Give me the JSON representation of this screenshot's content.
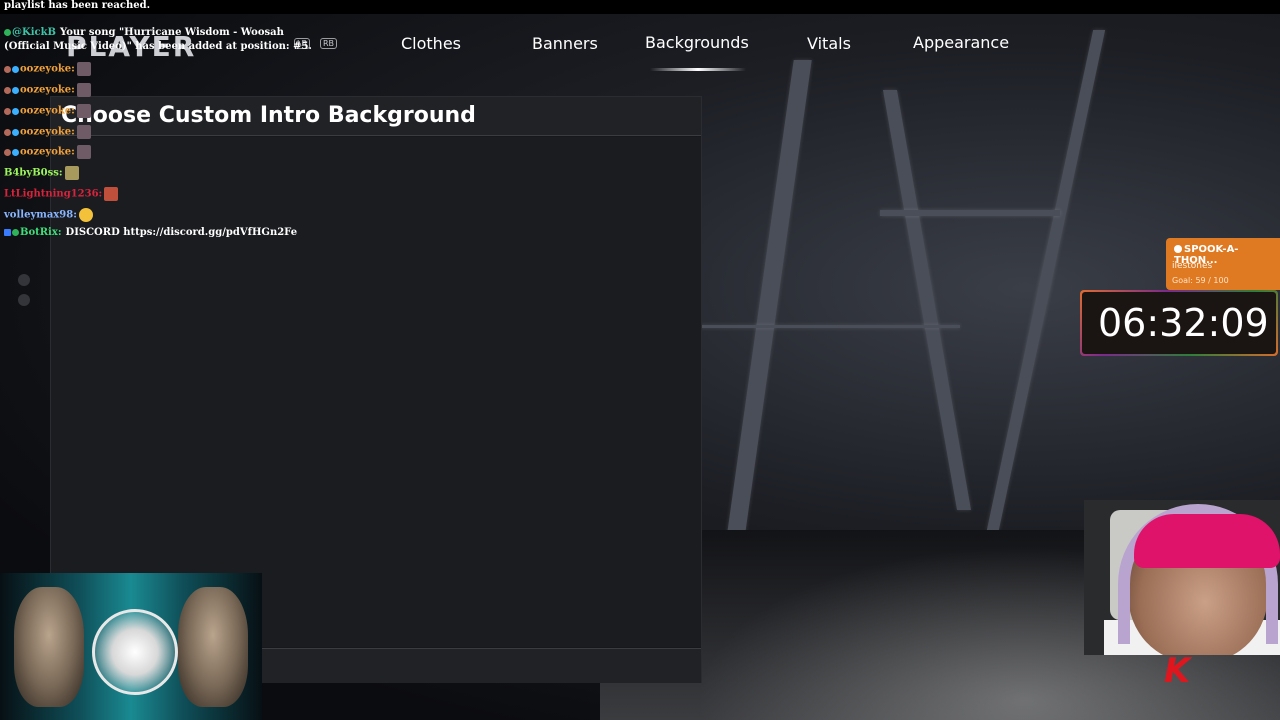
{
  "topbar": {
    "text": "playlist has been reached."
  },
  "game": {
    "logo_text": "PLAYER",
    "hints": {
      "lb": "LB",
      "rb": "RB"
    },
    "tabs": [
      {
        "label": "Clothes"
      },
      {
        "label": "Banners"
      },
      {
        "label": "Backgrounds",
        "active": true
      },
      {
        "label": "Vitals"
      },
      {
        "label": "Appearance"
      }
    ],
    "panel": {
      "title": "Choose Custom Intro Background"
    }
  },
  "chat": {
    "line0": {
      "user": "@KickB",
      "message": "Your song \"Hurricane Wisdom - Woosah (Official Music Video)\" has been added at position: #5."
    },
    "lines": [
      {
        "user": "oozeyoke:",
        "color": "#f2a23a"
      },
      {
        "user": "oozeyoke:",
        "color": "#f2a23a"
      },
      {
        "user": "oozeyoke:",
        "color": "#f2a23a"
      },
      {
        "user": "oozeyoke:",
        "color": "#f2a23a"
      },
      {
        "user": "oozeyoke:",
        "color": "#f2a23a"
      },
      {
        "user": "B4byB0ss:",
        "color": "#9cf55b"
      },
      {
        "user": "LtLightning1236:",
        "color": "#d8233c"
      },
      {
        "user": "volleymax98:",
        "color": "#8ab7ff"
      }
    ],
    "bot": {
      "user": "BotRix:",
      "message": "DISCORD https://discord.gg/pdVfHGn2Fe"
    }
  },
  "overlay": {
    "goal_title": "SPOOK-A-THON...",
    "goal_label": "ilestones",
    "goal_count": "Goal: 59 / 100",
    "timer": "06:32:09",
    "k_logo": "K"
  },
  "colors": {
    "accent_goal": "#e07a22",
    "brand_k": "#e0161f",
    "panel_bg": "#17181b"
  }
}
